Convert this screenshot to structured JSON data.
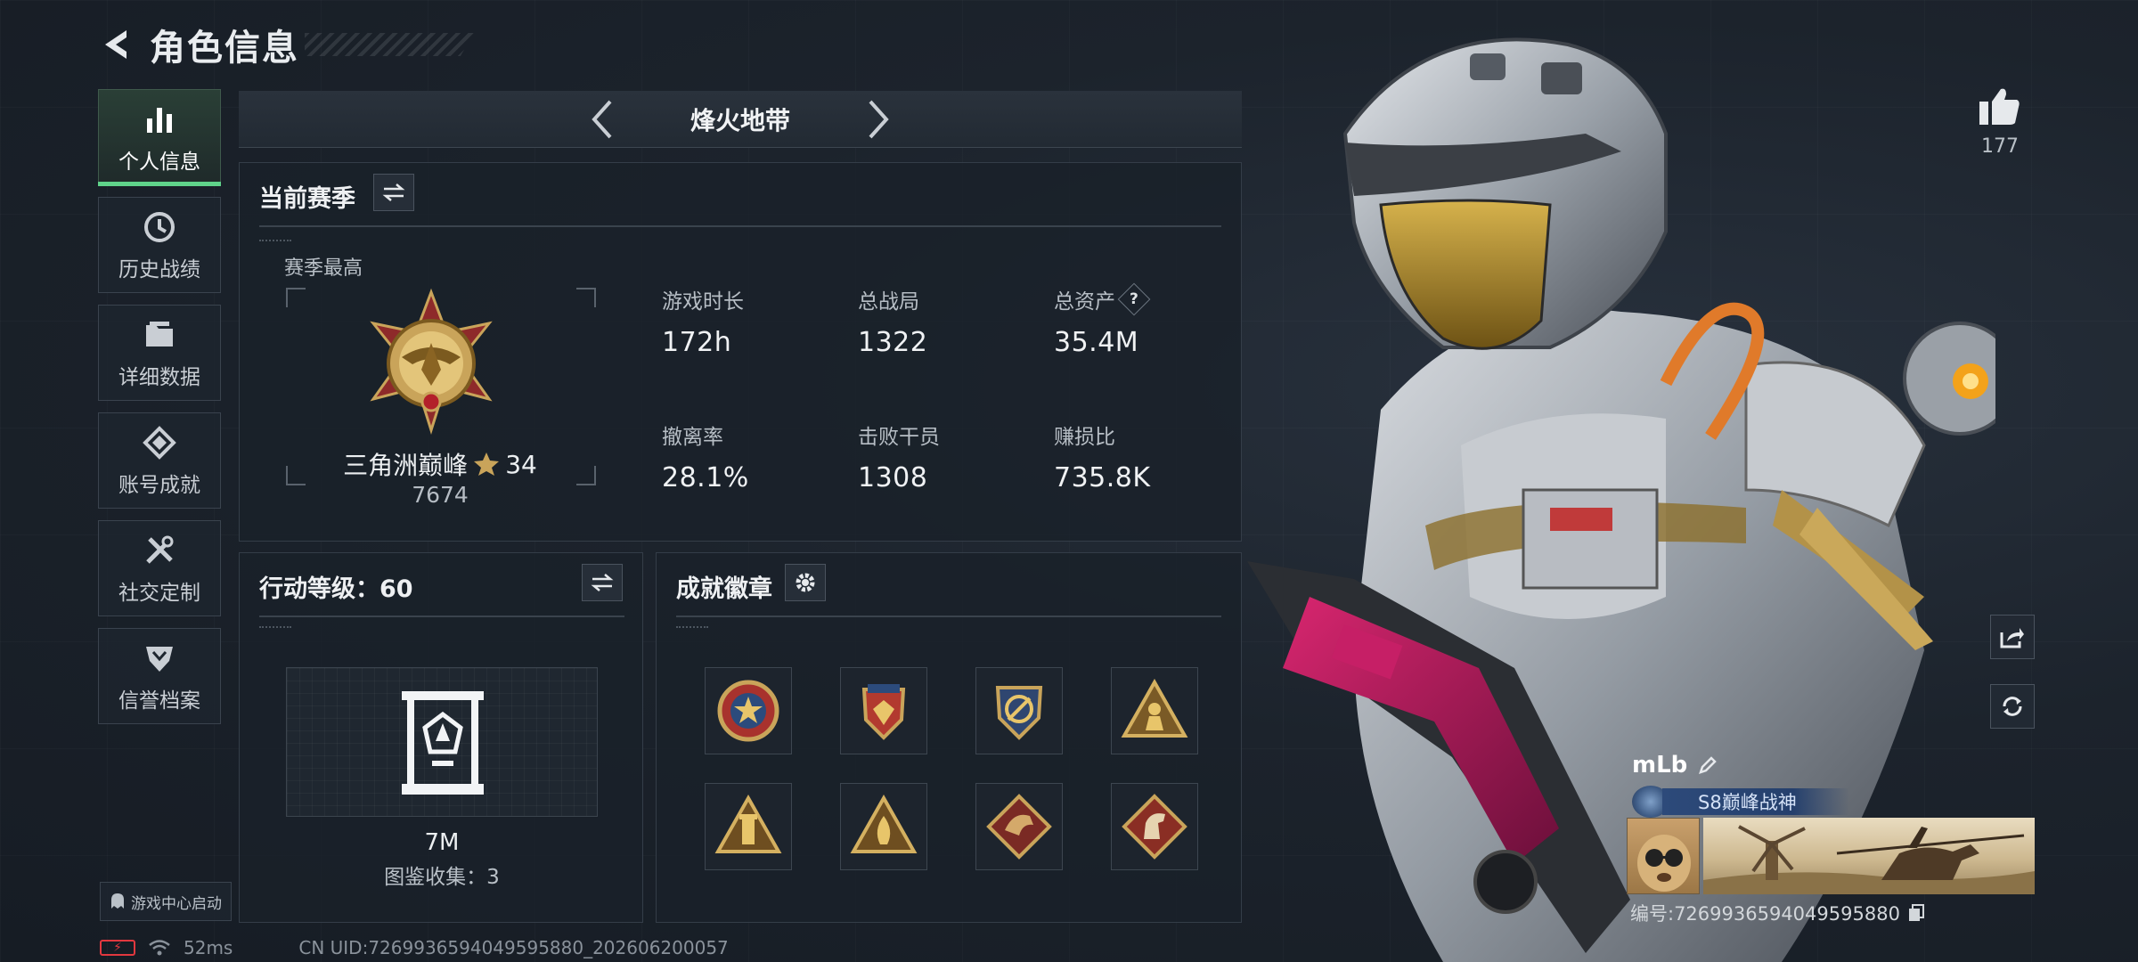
{
  "header": {
    "title": "角色信息"
  },
  "sidebar": {
    "items": [
      {
        "label": "个人信息",
        "icon": "bar-chart-icon",
        "active": true
      },
      {
        "label": "历史战绩",
        "icon": "clock-icon"
      },
      {
        "label": "详细数据",
        "icon": "folder-icon"
      },
      {
        "label": "账号成就",
        "icon": "achievement-icon"
      },
      {
        "label": "社交定制",
        "icon": "tools-icon"
      },
      {
        "label": "信誉档案",
        "icon": "shield-chevron-icon"
      }
    ],
    "launch_label": "游戏中心启动"
  },
  "season_nav": {
    "name": "烽火地带"
  },
  "season": {
    "title": "当前赛季",
    "highest_label": "赛季最高",
    "rank_name": "三角洲巅峰",
    "rank_stars": "34",
    "rank_score": "7674",
    "stats": [
      {
        "label": "游戏时长",
        "value": "172h"
      },
      {
        "label": "总战局",
        "value": "1322"
      },
      {
        "label": "总资产",
        "value": "35.4M",
        "help": "?"
      },
      {
        "label": "撤离率",
        "value": "28.1%"
      },
      {
        "label": "击败干员",
        "value": "1308"
      },
      {
        "label": "赚损比",
        "value": "735.8K"
      }
    ]
  },
  "level": {
    "title": "行动等级：60",
    "collection_value": "7M",
    "collection_count": "图鉴收集：3"
  },
  "badges": {
    "title": "成就徽章",
    "items": [
      "star-medal-icon",
      "wing-shield-medal-icon",
      "blue-shield-medal-icon",
      "triangle-soldier-badge-icon",
      "triangle-tower-badge-icon",
      "triangle-flame-badge-icon",
      "diamond-dragon-badge-icon",
      "diamond-horse-badge-icon"
    ]
  },
  "profile": {
    "likes": "177",
    "name": "mLb",
    "title": "S8巅峰战神",
    "id_text": "编号:7269936594049595880"
  },
  "status": {
    "ping": "52ms",
    "uid": "CN UID:7269936594049595880_202606200057"
  },
  "colors": {
    "accent": "#5fd38a",
    "battery_low": "#e2383f",
    "gold": "#c9a45a"
  }
}
